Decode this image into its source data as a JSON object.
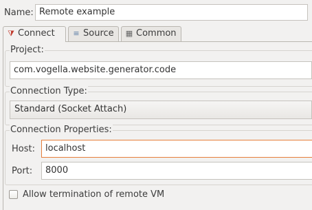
{
  "name_row": {
    "label": "Name:",
    "value": "Remote example"
  },
  "tabs": [
    {
      "label": "Connect",
      "icon": "debug-connect-icon",
      "active": true
    },
    {
      "label": "Source",
      "icon": "source-icon",
      "active": false
    },
    {
      "label": "Common",
      "icon": "common-icon",
      "active": false
    }
  ],
  "project": {
    "title": "Project:",
    "value": "com.vogella.website.generator.code"
  },
  "connection_type": {
    "title": "Connection Type:",
    "value": "Standard (Socket Attach)"
  },
  "connection_properties": {
    "title": "Connection Properties:",
    "host_label": "Host:",
    "host_value": "localhost",
    "port_label": "Port:",
    "port_value": "8000"
  },
  "allow_termination": {
    "label": "Allow termination of remote VM",
    "checked": false
  },
  "colors": {
    "focus_border": "#e67e3a",
    "connect_icon": "#c0392b"
  }
}
